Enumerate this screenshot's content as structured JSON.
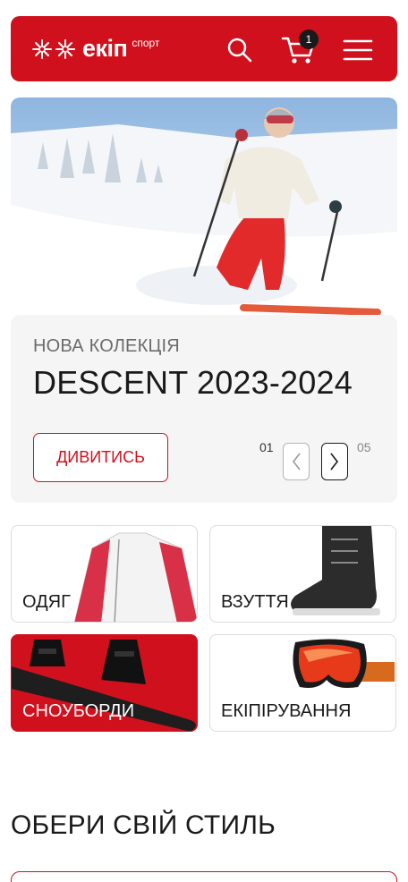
{
  "header": {
    "logo_text": "екіп",
    "logo_sub": "спорт",
    "cart_count": "1",
    "brand_color": "#d0101c"
  },
  "hero": {
    "kicker": "НОВА КОЛЕКЦІЯ",
    "title": "DESCENT 2023-2024",
    "cta_label": "ДИВИТИСЬ",
    "slide_current": "01",
    "slide_total": "05"
  },
  "categories": [
    {
      "label": "ОДЯГ"
    },
    {
      "label": "ВЗУТТЯ"
    },
    {
      "label": "СНОУБОРДИ"
    },
    {
      "label": "ЕКІПІРУВАННЯ"
    }
  ],
  "section": {
    "title": "ОБЕРИ СВІЙ СТИЛЬ"
  },
  "icons": [
    "snowflake-icon",
    "search-icon",
    "cart-icon",
    "menu-icon",
    "chevron-left-icon",
    "chevron-right-icon"
  ]
}
